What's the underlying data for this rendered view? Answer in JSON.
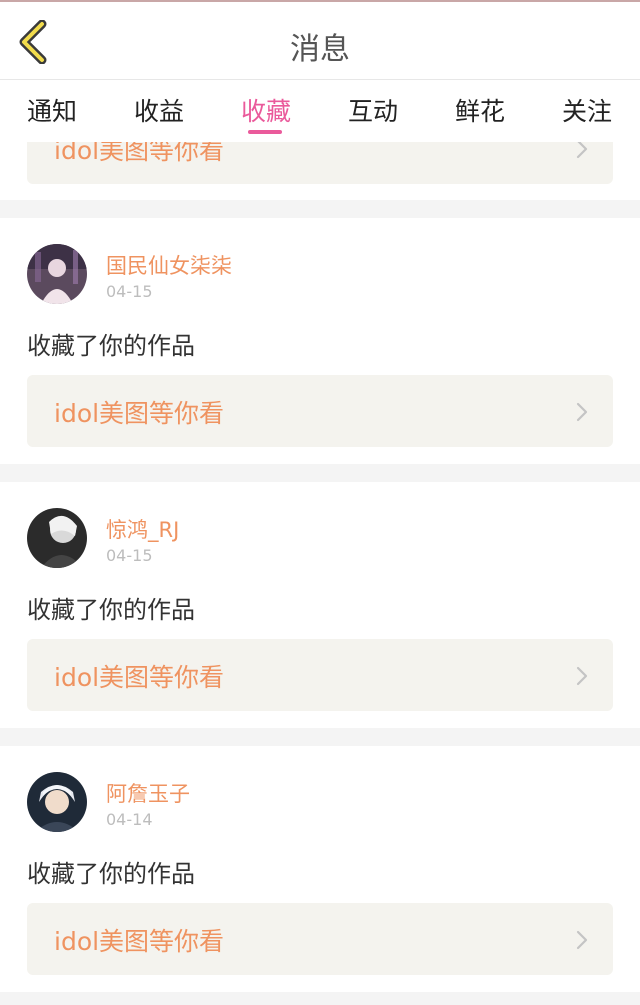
{
  "header": {
    "title": "消息",
    "back_icon": "chevron-left-icon"
  },
  "tabs": [
    {
      "label": "通知",
      "active": false
    },
    {
      "label": "收益",
      "active": false
    },
    {
      "label": "收藏",
      "active": true
    },
    {
      "label": "互动",
      "active": false
    },
    {
      "label": "鲜花",
      "active": false
    },
    {
      "label": "关注",
      "active": false
    }
  ],
  "colors": {
    "accent": "#ea5a9b",
    "username": "#ef9360",
    "link_bg": "#f4f3ee"
  },
  "partial_card": {
    "link_text": "idol美图等你看"
  },
  "messages": [
    {
      "username": "国民仙女柒柒",
      "date": "04-15",
      "action": "收藏了你的作品",
      "link_text": "idol美图等你看"
    },
    {
      "username": "惊鸿_RJ",
      "date": "04-15",
      "action": "收藏了你的作品",
      "link_text": "idol美图等你看"
    },
    {
      "username": "阿詹玉子",
      "date": "04-14",
      "action": "收藏了你的作品",
      "link_text": "idol美图等你看"
    }
  ]
}
